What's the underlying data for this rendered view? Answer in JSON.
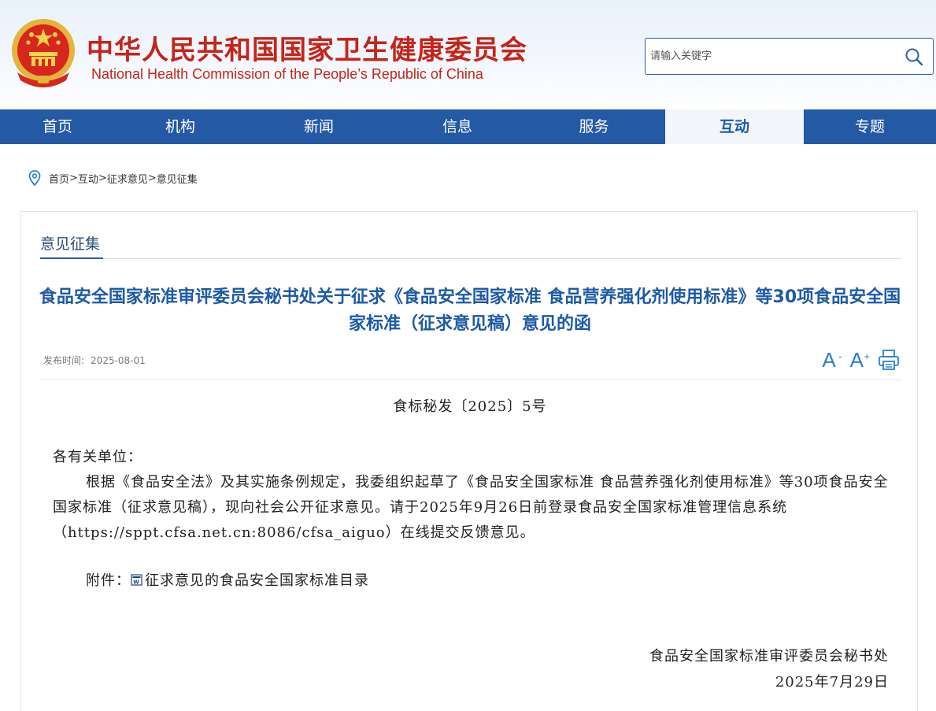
{
  "colors": {
    "brand_red": "#c5241b",
    "nav_blue": "#2459a5",
    "title_blue": "#1d5aa5",
    "active_tab_bg": "#f2f6fb"
  },
  "header": {
    "title_cn": "中华人民共和国国家卫生健康委员会",
    "title_en": "National Health Commission of the People’s  Republic of China",
    "emblem_icon": "national-emblem-icon"
  },
  "search": {
    "placeholder": "请输入关键字",
    "icon": "search-icon"
  },
  "nav": {
    "items": [
      {
        "label": "首页"
      },
      {
        "label": "机构"
      },
      {
        "label": "新闻"
      },
      {
        "label": "信息"
      },
      {
        "label": "服务"
      },
      {
        "label": "互动",
        "active": true
      },
      {
        "label": "专题"
      }
    ]
  },
  "breadcrumb": {
    "icon": "location-pin-icon",
    "items": [
      "首页",
      "互动",
      "征求意见",
      "意见征集"
    ],
    "separator": ">"
  },
  "section": {
    "title": "意见征集"
  },
  "article": {
    "title": "食品安全国家标准审评委员会秘书处关于征求《食品安全国家标准 食品营养强化剂使用标准》等30项食品安全国家标准（征求意见稿）意见的函",
    "pub_label": "发布时间:",
    "pub_date": "2025-08-01",
    "font_decrease": "A",
    "font_decrease_sup": "-",
    "font_increase": "A",
    "font_increase_sup": "+",
    "print_icon": "print-icon",
    "doc_number": "食标秘发〔2025〕5号",
    "salutation": "各有关单位：",
    "body": "根据《食品安全法》及其实施条例规定，我委组织起草了《食品安全国家标准 食品营养强化剂使用标准》等30项食品安全国家标准（征求意见稿），现向社会公开征求意见。请于2025年9月26日前登录食品安全国家标准管理信息系统（https://sppt.cfsa.net.cn:8086/cfsa_aiguo）在线提交反馈意见。",
    "attachment_label": "附件：",
    "attachment_icon": "word-document-icon",
    "attachment_link": "征求意见的食品安全国家标准目录",
    "signature_org": "食品安全国家标准审评委员会秘书处",
    "signature_date": "2025年7月29日"
  }
}
